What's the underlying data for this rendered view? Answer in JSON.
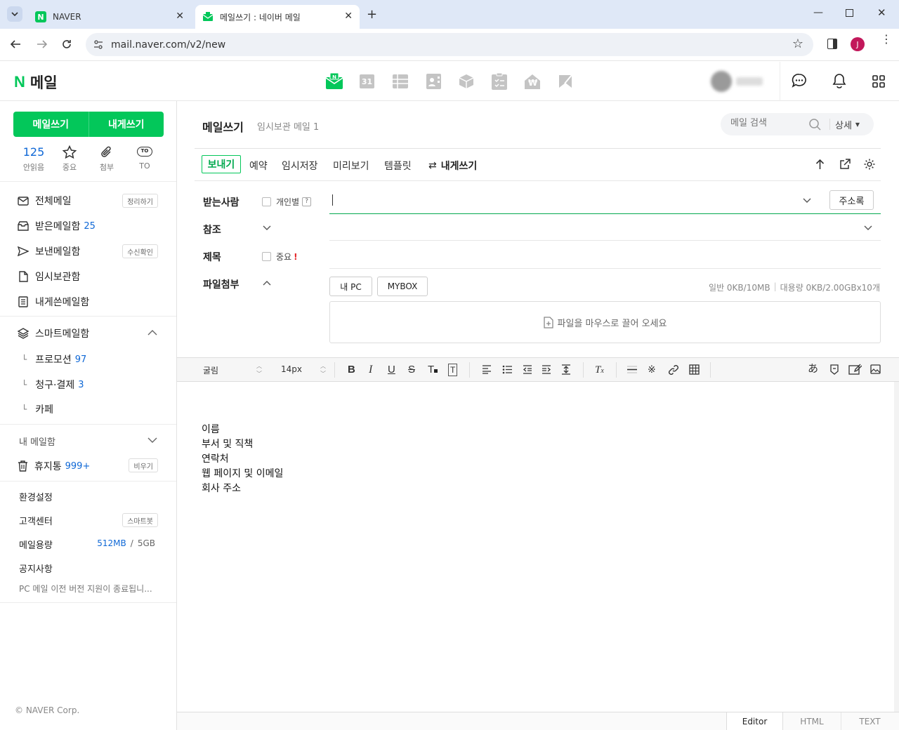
{
  "browser": {
    "tabs": [
      {
        "title": "NAVER",
        "favicon": "N"
      },
      {
        "title": "메일쓰기 : 네이버 메일"
      }
    ],
    "url": "mail.naver.com/v2/new",
    "profile_initial": "J"
  },
  "header": {
    "logo_n": "N",
    "logo_text": "메일",
    "calendar_num": "31",
    "pay_symbol": "₩"
  },
  "sidebar": {
    "compose_label": "메일쓰기",
    "self_compose_label": "내게쓰기",
    "quick": [
      {
        "top": "125",
        "label": "안읽음"
      },
      {
        "label": "중요",
        "icon": "star-icon"
      },
      {
        "label": "첨부",
        "icon": "paperclip-icon"
      },
      {
        "label": "TO",
        "icon": "to-icon"
      }
    ],
    "to_badge": "TO",
    "folders": [
      {
        "label": "전체메일",
        "action": "정리하기"
      },
      {
        "label": "받은메일함",
        "count": "25"
      },
      {
        "label": "보낸메일함",
        "action": "수신확인"
      },
      {
        "label": "임시보관함"
      },
      {
        "label": "내게쓴메일함"
      }
    ],
    "smart_title": "스마트메일함",
    "smart_items": [
      {
        "label": "프로모션",
        "count": "97"
      },
      {
        "label": "청구·결제",
        "count": "3"
      },
      {
        "label": "카페",
        "count": ""
      }
    ],
    "sub_marker": "└",
    "my_mailbox": "내 메일함",
    "trash": {
      "label": "휴지통",
      "count": "999+",
      "action": "비우기"
    },
    "settings": "환경설정",
    "support": {
      "label": "고객센터",
      "action": "스마트봇"
    },
    "storage": {
      "label": "메일용량",
      "used": "512MB",
      "sep": "/",
      "total": "5GB"
    },
    "notice_title": "공지사항",
    "notice_text": "PC 메일 이전 버전 지원이 종료됩니...",
    "copyright": "© NAVER Corp."
  },
  "compose": {
    "title": "메일쓰기",
    "drafts": "임시보관 메일 1",
    "search_placeholder": "메일 검색",
    "detail": "상세",
    "toolbar": {
      "send": "보내기",
      "reserve": "예약",
      "save": "임시저장",
      "preview": "미리보기",
      "template": "템플릿",
      "self": "내게쓰기"
    },
    "to_label": "받는사람",
    "individual": "개인별",
    "help_mark": "?",
    "address_book": "주소록",
    "cc_label": "참조",
    "subject_label": "제목",
    "important": "중요",
    "important_mark": "!",
    "attach_label": "파일첨부",
    "my_pc": "내 PC",
    "mybox": "MYBOX",
    "quota_normal": "일반 0KB/10MB",
    "quota_divider": "|",
    "quota_large": "대용량 0KB/2.00GBx10개",
    "drop_hint": "파일을 마우스로 끌어 오세요"
  },
  "editor": {
    "font": "굴림",
    "size": "14px",
    "body_lines": [
      "이름",
      "부서 및 직책",
      "연락처",
      "웹 페이지 및 이메일",
      "회사 주소"
    ],
    "modes": [
      "Editor",
      "HTML",
      "TEXT"
    ]
  },
  "colors": {
    "brand": "#03c75a",
    "link": "#0f68d6"
  }
}
